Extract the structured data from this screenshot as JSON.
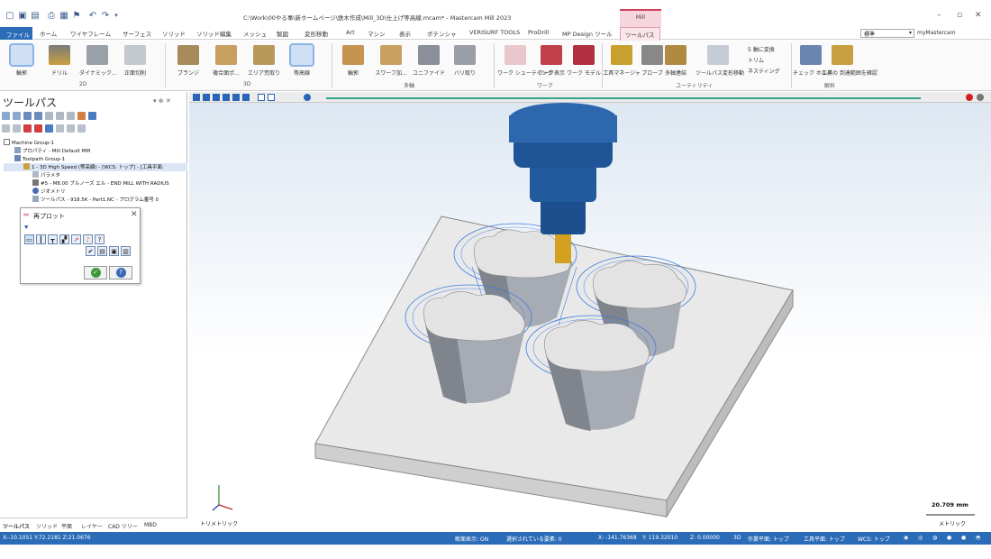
{
  "window": {
    "title": "C:\\Work\\00やる事\\新ホームページ\\鉄木作成\\Mill_3D\\仕上げ等高線.mcam* - Mastercam Mill 2023",
    "context_tab": "Mill"
  },
  "ribbon_tabs": [
    "ファイル",
    "ホーム",
    "ワイヤフレーム",
    "サーフェス",
    "ソリッド",
    "ソリッド編集",
    "メッシュ",
    "製図",
    "変形移動",
    "Art",
    "マシン",
    "表示",
    "ポテンシャ",
    "VERISURF TOOLS",
    "ProDrill",
    "MP Design ツール",
    "ツールパス"
  ],
  "ribbon_right": {
    "dropdown": "標準",
    "account": "myMastercam"
  },
  "ribbon": {
    "groups": [
      "2D",
      "3D",
      "多軸",
      "ワーク",
      "ユーティリティ",
      "解析"
    ],
    "buttons_2d": [
      "輪郭",
      "ドリル",
      "ダイナミック...",
      "正面切削"
    ],
    "buttons_3d": [
      "ブランジ",
      "複合面ポ...",
      "エリア荒取り",
      "等高線"
    ],
    "buttons_multi": [
      "輪郭",
      "スワーフ加...",
      "ユニファイド",
      "バリ取り"
    ],
    "buttons_work": [
      "ワーク\nシューティング",
      "ワーク表示",
      "ワーク\nモデル"
    ],
    "buttons_util": [
      "工具マネージャ",
      "プローブ",
      "多軸連結",
      "ツールパス変形移動"
    ],
    "util_small": [
      "5 軸に変換",
      "トリム",
      "ネスティング"
    ],
    "buttons_analysis": [
      "チェック\nホルダ",
      "工具の\n到達範囲を確認"
    ]
  },
  "left_panel": {
    "title": "ツールパス",
    "tree": [
      "Machine Group-1",
      "プロパティ - Mill Default MM",
      "Toolpath Group-1",
      "1 - 3D High Speed (等高線) - [WCS: トップ] - [工具平面:",
      "パラメタ",
      "#5 - M8.00 ブルノーズ エル - END MILL WITH RADIUS",
      "ジオメトリ",
      "ツールパス - 918.5K - Part1.NC - プログラム番号 0"
    ],
    "dialog_title": "再プロット",
    "bottom_tabs": [
      "ツールパス",
      "ソリッド",
      "平面",
      "レイヤー",
      "CAD ツリー",
      "MBD"
    ]
  },
  "viewport": {
    "view_label": "トリメトリック",
    "scale_value": "20.709 mm",
    "scale_unit": "メトリック"
  },
  "status": {
    "coords_left": "X:-10.1051  Y:72.2181  Z:21.0676",
    "section": "断面表示: ON",
    "selected": "選択されている要素: 0",
    "x": "X:  -141.76368",
    "y": "Y:  119.32010",
    "z": "Z:  0.00000",
    "mode": "3D",
    "cplane": "作業平面: トップ",
    "tplane": "工具平面: トップ",
    "wcs": "WCS: トップ"
  },
  "colors": {
    "ribbon_blue": "#2b6cb8",
    "toolpath_blue": "#3d7be0",
    "tool_blue": "#1d4f8e",
    "tool_tip": "#d4a020"
  }
}
